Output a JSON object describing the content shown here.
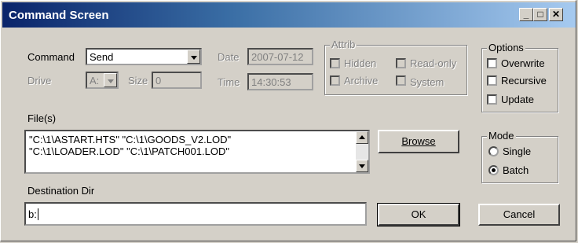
{
  "window": {
    "title": "Command Screen",
    "controls": {
      "minimize": "_",
      "maximize": "□",
      "close": "✕"
    }
  },
  "command": {
    "label": "Command",
    "value": "Send"
  },
  "drive": {
    "label": "Drive",
    "value": "A:"
  },
  "size": {
    "label": "Size",
    "value": "0"
  },
  "date": {
    "label": "Date",
    "value": "2007-07-12"
  },
  "time": {
    "label": "Time",
    "value": "14:30:53"
  },
  "attrib": {
    "legend": "Attrib",
    "hidden": "Hidden",
    "readonly": "Read-only",
    "archive": "Archive",
    "system": "System"
  },
  "options": {
    "legend": "Options",
    "overwrite": "Overwrite",
    "recursive": "Recursive",
    "update": "Update"
  },
  "files": {
    "label": "File(s)",
    "lines": [
      "\"C:\\1\\ASTART.HTS\" \"C:\\1\\GOODS_V2.LOD\"",
      "\"C:\\1\\LOADER.LOD\" \"C:\\1\\PATCH001.LOD\""
    ]
  },
  "browse_label": "Browse",
  "mode": {
    "legend": "Mode",
    "single": "Single",
    "batch": "Batch",
    "selected": "Batch"
  },
  "destination": {
    "label": "Destination Dir",
    "value": "b:"
  },
  "ok_label": "OK",
  "cancel_label": "Cancel"
}
